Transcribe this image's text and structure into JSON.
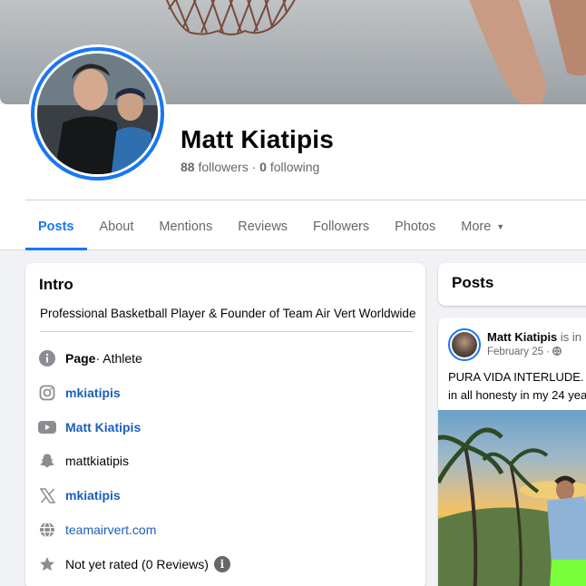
{
  "profile": {
    "name": "Matt Kiatipis",
    "followers_count": "88",
    "followers_label": "followers",
    "separator": " · ",
    "following_count": "0",
    "following_label": "following"
  },
  "tabs": [
    {
      "label": "Posts",
      "active": true
    },
    {
      "label": "About"
    },
    {
      "label": "Mentions"
    },
    {
      "label": "Reviews"
    },
    {
      "label": "Followers"
    },
    {
      "label": "Photos"
    },
    {
      "label": "More"
    }
  ],
  "intro": {
    "title": "Intro",
    "bio": "Professional Basketball Player & Founder of Team Air Vert Worldwide",
    "rows": [
      {
        "icon": "info-icon",
        "label": "Page",
        "detail": " · Athlete"
      },
      {
        "icon": "instagram-icon",
        "label": "mkiatipis"
      },
      {
        "icon": "youtube-icon",
        "label": "Matt Kiatipis"
      },
      {
        "icon": "snapchat-icon",
        "label": "mattkiatipis"
      },
      {
        "icon": "x-icon",
        "label": "mkiatipis"
      },
      {
        "icon": "globe-icon",
        "label": "teamairvert.com"
      },
      {
        "icon": "star-icon",
        "label": "Not yet rated (0 Reviews)"
      }
    ]
  },
  "posts_section": {
    "title": "Posts"
  },
  "post": {
    "author": "Matt Kiatipis",
    "author_suffix": " is in",
    "date": "February 25 · ",
    "text_line1": "PURA VIDA INTERLUDE. ",
    "text_line2": "in all honesty in my 24 yea"
  },
  "colors": {
    "accent": "#1877f2",
    "link": "#1b5fbf",
    "muted": "#65676b"
  }
}
